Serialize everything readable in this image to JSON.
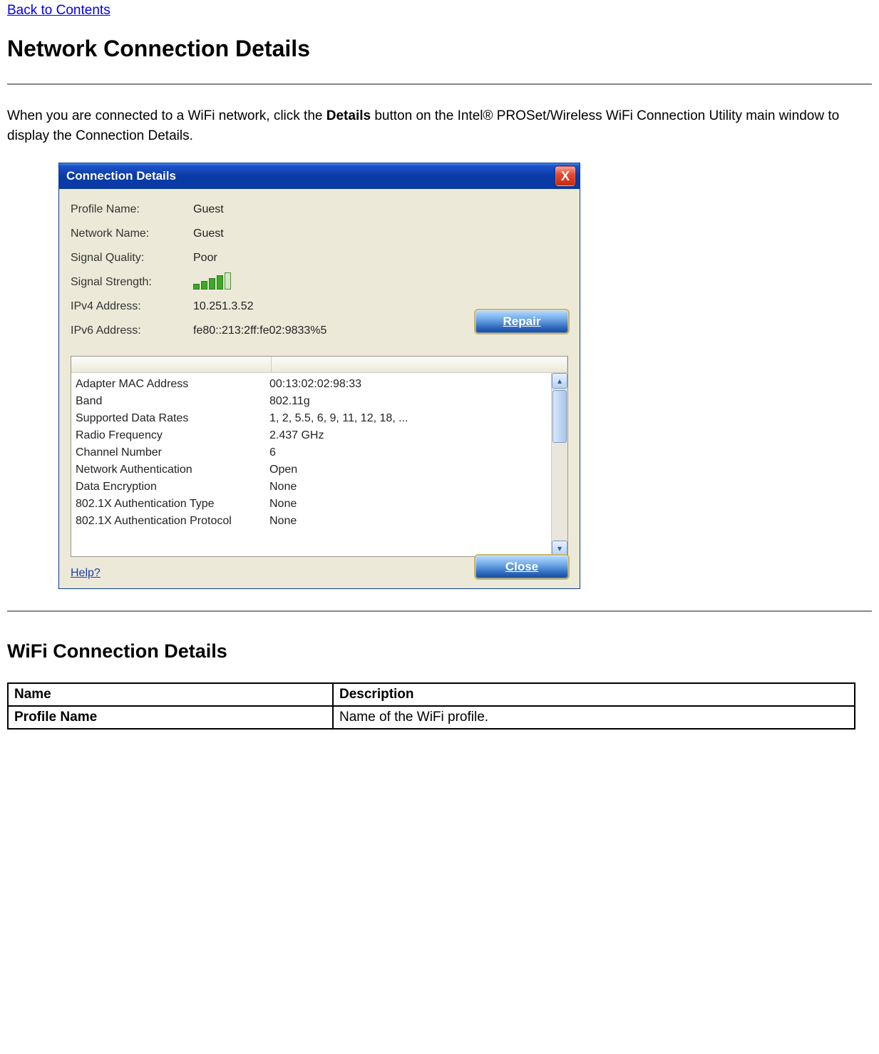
{
  "nav": {
    "back_link": "Back to Contents"
  },
  "headings": {
    "main": "Network Connection Details",
    "sub": "WiFi Connection Details"
  },
  "intro": {
    "before_bold": "When you are connected to a WiFi network, click the ",
    "bold": "Details",
    "after_bold": " button on the Intel® PROSet/Wireless WiFi Connection Utility main window to display the Connection Details."
  },
  "dialog": {
    "title": "Connection Details",
    "close_x": "X",
    "fields": {
      "profile": {
        "label": "Profile Name:",
        "value": "Guest"
      },
      "network": {
        "label": "Network Name:",
        "value": "Guest"
      },
      "quality": {
        "label": "Signal Quality:",
        "value": "Poor"
      },
      "strength": {
        "label": "Signal Strength:"
      },
      "ipv4": {
        "label": "IPv4 Address:",
        "value": "10.251.3.52"
      },
      "ipv6": {
        "label": "IPv6 Address:",
        "value": "fe80::213:2ff:fe02:9833%5"
      }
    },
    "repair_label": "Repair",
    "close_label": "Close",
    "help_label": "Help?",
    "list": [
      {
        "name": "Adapter MAC Address",
        "value": "00:13:02:02:98:33"
      },
      {
        "name": "Band",
        "value": "802.11g"
      },
      {
        "name": "Supported Data Rates",
        "value": "1, 2, 5.5, 6, 9, 11, 12, 18, ..."
      },
      {
        "name": "Radio Frequency",
        "value": "2.437 GHz"
      },
      {
        "name": "Channel Number",
        "value": "6"
      },
      {
        "name": "Network Authentication",
        "value": "Open"
      },
      {
        "name": "Data Encryption",
        "value": "None"
      },
      {
        "name": "802.1X Authentication Type",
        "value": "None"
      },
      {
        "name": "802.1X Authentication Protocol",
        "value": "None"
      }
    ],
    "scroll_up": "▴",
    "scroll_down": "▾"
  },
  "table": {
    "header_name": "Name",
    "header_desc": "Description",
    "rows": [
      {
        "name": "Profile Name",
        "desc": "Name of the WiFi profile."
      }
    ]
  }
}
